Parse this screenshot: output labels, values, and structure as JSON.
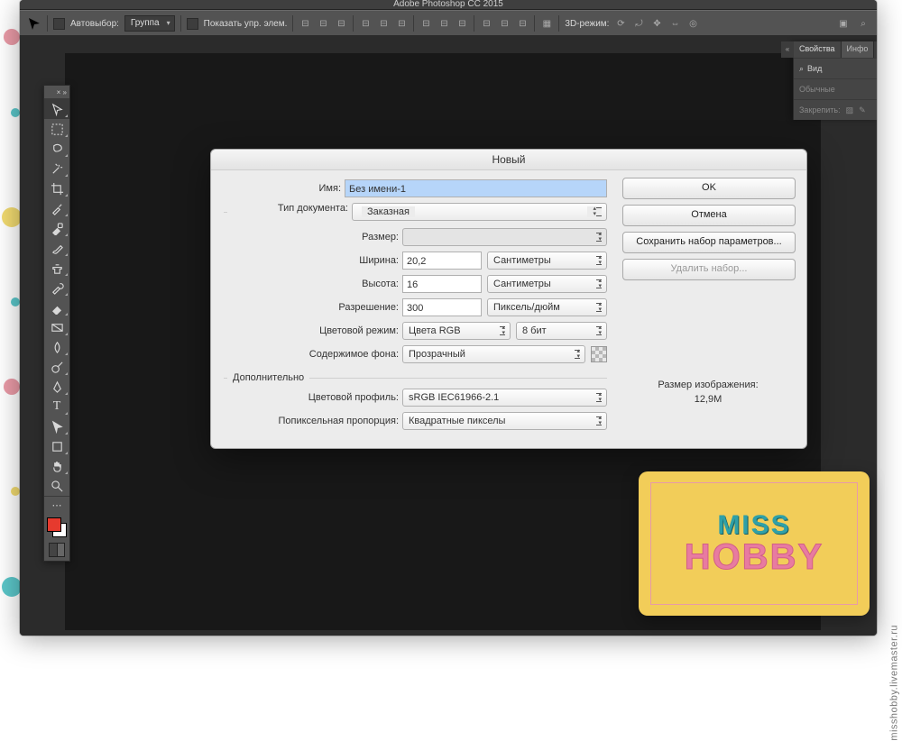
{
  "app": {
    "title": "Adobe Photoshop CC 2015",
    "options_bar": {
      "autoselect_label": "Автовыбор:",
      "autoselect_mode": "Группа",
      "show_transform_label": "Показать упр. элем.",
      "mode3d_label": "3D-режим:"
    }
  },
  "panels": {
    "tab1": "Свойства",
    "tab2": "Инфо",
    "row_view": "Вид",
    "row_normal": "Обычные",
    "row_lock": "Закрепить:"
  },
  "dialog": {
    "title": "Новый",
    "name_label": "Имя:",
    "name_value": "Без имени-1",
    "doc_type_label": "Тип документа:",
    "doc_type_value": "Заказная",
    "size_label": "Размер:",
    "size_value": "",
    "width_label": "Ширина:",
    "width_value": "20,2",
    "width_unit": "Сантиметры",
    "height_label": "Высота:",
    "height_value": "16",
    "height_unit": "Сантиметры",
    "res_label": "Разрешение:",
    "res_value": "300",
    "res_unit": "Пиксель/дюйм",
    "color_mode_label": "Цветовой режим:",
    "color_mode_value": "Цвета RGB",
    "bit_depth": "8 бит",
    "bg_label": "Содержимое фона:",
    "bg_value": "Прозрачный",
    "advanced_label": "Дополнительно",
    "profile_label": "Цветовой профиль:",
    "profile_value": "sRGB IEC61966-2.1",
    "aspect_label": "Попиксельная пропорция:",
    "aspect_value": "Квадратные пикселы",
    "buttons": {
      "ok": "OK",
      "cancel": "Отмена",
      "save_preset": "Сохранить набор параметров...",
      "delete_preset": "Удалить набор..."
    },
    "image_size_label": "Размер изображения:",
    "image_size_value": "12,9М"
  },
  "branding": {
    "miss": "MISS",
    "hobby": "HOBBY",
    "source": "misshobby.livemaster.ru"
  }
}
